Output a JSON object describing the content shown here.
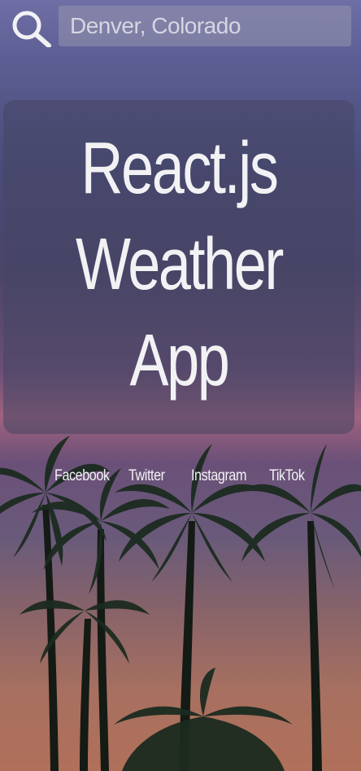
{
  "search": {
    "placeholder": "Denver, Colorado",
    "icon": "search-icon"
  },
  "app": {
    "title_line1": "React.js",
    "title_line2": "Weather",
    "title_line3": "App"
  },
  "social_links": [
    {
      "label": "Facebook"
    },
    {
      "label": "Twitter"
    },
    {
      "label": "Instagram"
    },
    {
      "label": "TikTok"
    }
  ],
  "colors": {
    "sky_top": "#6f6fa6",
    "sky_pink": "#a0627f",
    "sky_bottom": "#b0705a",
    "card_overlay": "#46466480",
    "text": "#f2f2f5"
  }
}
